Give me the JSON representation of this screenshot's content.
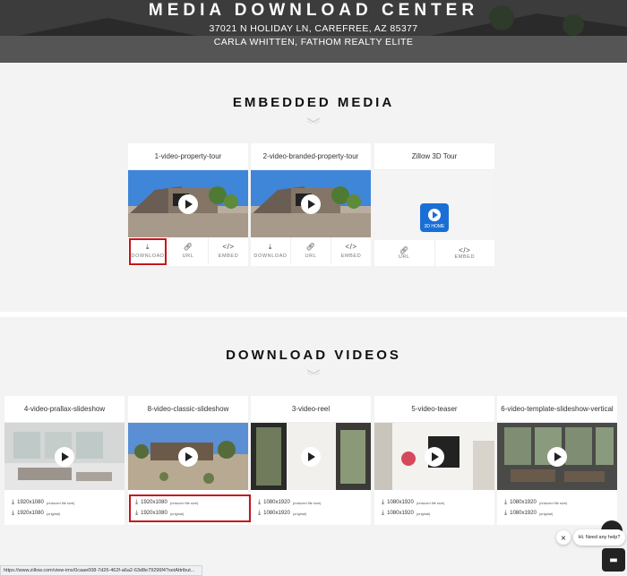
{
  "hero": {
    "title": "MEDIA DOWNLOAD CENTER",
    "address": "37021 N HOLIDAY LN, CAREFREE, AZ 85377",
    "agent": "CARLA WHITTEN, FATHOM REALTY ELITE"
  },
  "embedded": {
    "title": "EMBEDDED MEDIA",
    "cards": [
      {
        "name": "1-video-property-tour",
        "actions": [
          "DOWNLOAD",
          "URL",
          "EMBED"
        ]
      },
      {
        "name": "2-video-branded-property-tour",
        "actions": [
          "DOWNLOAD",
          "URL",
          "EMBED"
        ]
      },
      {
        "name": "Zillow 3D Tour",
        "logo_label": "3D HOME",
        "actions": [
          "URL",
          "EMBED"
        ]
      }
    ]
  },
  "downloads": {
    "title": "DOWNLOAD VIDEOS",
    "reduced_note": "(reduced file size)",
    "original_note": "(original)",
    "cards": [
      {
        "name": "4-video-prallax-slideshow",
        "res1": "1920x1080",
        "res2": "1920x1080"
      },
      {
        "name": "8-video-classic-slideshow",
        "res1": "1920x1080",
        "res2": "1920x1080"
      },
      {
        "name": "3-video-reel",
        "res1": "1080x1920",
        "res2": "1080x1920"
      },
      {
        "name": "5-video-teaser",
        "res1": "1080x1920",
        "res2": "1080x1920"
      },
      {
        "name": "6-video-template-slideshow-vertical",
        "res1": "1080x1920",
        "res2": "1080x1920"
      }
    ]
  },
  "chat": {
    "message": "Hi. Need any help?",
    "close": "×"
  },
  "status_bar": {
    "url": "https://www.zillow.com/view-imx/0caae008-7d26-462f-a6a2-63d8e79296f4?setAttribut..."
  },
  "icons": {
    "download": "download-icon",
    "link": "link-icon",
    "code": "code-icon"
  },
  "colors": {
    "highlight": "#c4161c",
    "zillow_blue": "#1a6fd6"
  }
}
